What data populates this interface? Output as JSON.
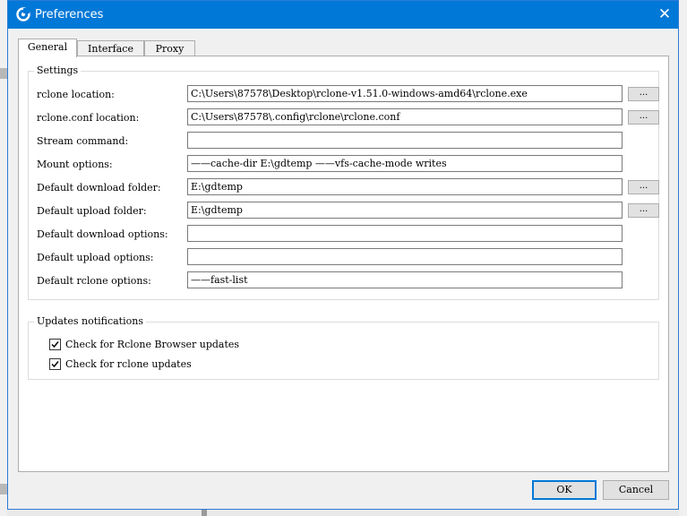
{
  "window": {
    "title": "Preferences",
    "close_glyph": "✕"
  },
  "tabs": [
    {
      "label": "General",
      "active": true
    },
    {
      "label": "Interface",
      "active": false
    },
    {
      "label": "Proxy",
      "active": false
    }
  ],
  "settings": {
    "title": "Settings",
    "browse_label": "...",
    "rows": [
      {
        "label": "rclone location:",
        "value": "C:\\Users\\87578\\Desktop\\rclone-v1.51.0-windows-amd64\\rclone.exe",
        "has_browse": true
      },
      {
        "label": "rclone.conf location:",
        "value": "C:\\Users\\87578\\.config\\rclone\\rclone.conf",
        "has_browse": true
      },
      {
        "label": "Stream command:",
        "value": "",
        "has_browse": false
      },
      {
        "label": "Mount options:",
        "value": "——cache-dir E:\\gdtemp ——vfs-cache-mode writes",
        "has_browse": false
      },
      {
        "label": "Default download folder:",
        "value": "E:\\gdtemp",
        "has_browse": true
      },
      {
        "label": "Default upload folder:",
        "value": "E:\\gdtemp",
        "has_browse": true
      },
      {
        "label": "Default download options:",
        "value": "",
        "has_browse": false
      },
      {
        "label": "Default upload options:",
        "value": "",
        "has_browse": false
      },
      {
        "label": "Default rclone options:",
        "value": "——fast-list",
        "has_browse": false
      }
    ]
  },
  "updates": {
    "title": "Updates notifications",
    "checks": [
      {
        "label": "Check for Rclone Browser updates",
        "checked": true
      },
      {
        "label": "Check for rclone updates",
        "checked": true
      }
    ]
  },
  "buttons": {
    "ok": "OK",
    "cancel": "Cancel"
  },
  "colors": {
    "accent": "#0078d7",
    "titlebar": "#0078d7"
  }
}
